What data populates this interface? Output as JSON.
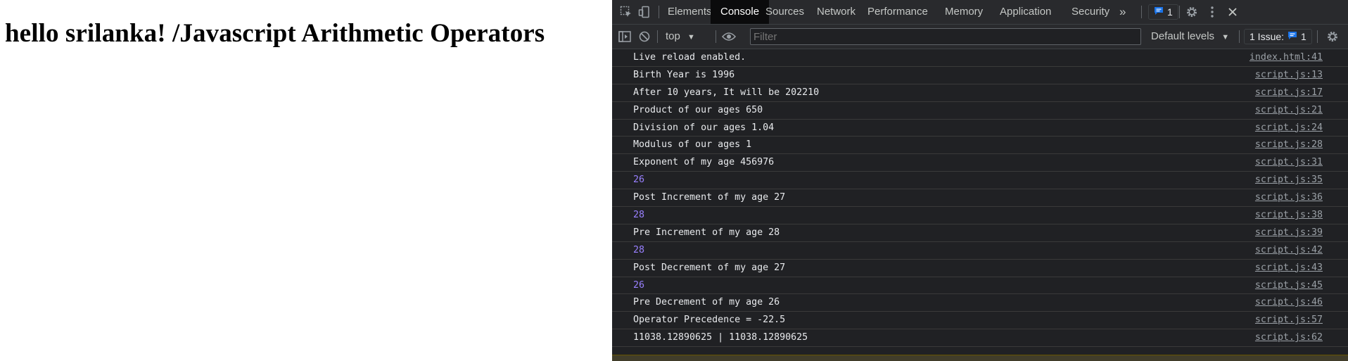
{
  "page": {
    "heading": "hello srilanka! /Javascript Arithmetic Operators"
  },
  "devtools": {
    "tabs": [
      "Elements",
      "Console",
      "Sources",
      "Network",
      "Performance",
      "Memory",
      "Application",
      "Security"
    ],
    "active_tab": "Console",
    "more_tabs": "»",
    "issue_badge_count": "1",
    "toolbar": {
      "context": "top",
      "filter_placeholder": "Filter",
      "levels": "Default levels",
      "issues_label": "1 Issue:",
      "issues_count": "1"
    },
    "console_rows": [
      {
        "message": "Live reload enabled.",
        "source": "index.html:41",
        "kind": "text"
      },
      {
        "message": "Birth Year is 1996",
        "source": "script.js:13",
        "kind": "text"
      },
      {
        "message": "After 10 years, It will be 202210",
        "source": "script.js:17",
        "kind": "text"
      },
      {
        "message": "Product of our ages 650",
        "source": "script.js:21",
        "kind": "text"
      },
      {
        "message": "Division of our ages 1.04",
        "source": "script.js:24",
        "kind": "text"
      },
      {
        "message": "Modulus of our ages 1",
        "source": "script.js:28",
        "kind": "text"
      },
      {
        "message": "Exponent of my age 456976",
        "source": "script.js:31",
        "kind": "text"
      },
      {
        "message": "26",
        "source": "script.js:35",
        "kind": "number"
      },
      {
        "message": "Post Increment of my age 27",
        "source": "script.js:36",
        "kind": "text"
      },
      {
        "message": "28",
        "source": "script.js:38",
        "kind": "number"
      },
      {
        "message": "Pre Increment of my age 28",
        "source": "script.js:39",
        "kind": "text"
      },
      {
        "message": "28",
        "source": "script.js:42",
        "kind": "number"
      },
      {
        "message": "Post Decrement of my age 27",
        "source": "script.js:43",
        "kind": "text"
      },
      {
        "message": "26",
        "source": "script.js:45",
        "kind": "number"
      },
      {
        "message": "Pre Decrement of my age 26",
        "source": "script.js:46",
        "kind": "text"
      },
      {
        "message": "Operator Precedence = -22.5",
        "source": "script.js:57",
        "kind": "text"
      },
      {
        "message": "11038.12890625 | 11038.12890625",
        "source": "script.js:62",
        "kind": "text"
      }
    ]
  },
  "colors": {
    "devtools_bg": "#202124",
    "toolbar_bg": "#292a2d",
    "number_color": "#9980ff",
    "badge_blue": "#1a73e8"
  }
}
